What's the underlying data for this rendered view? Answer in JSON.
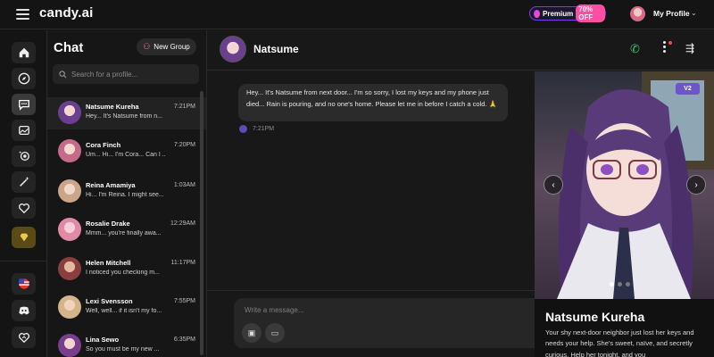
{
  "app": {
    "logo": "candy.ai"
  },
  "topbar": {
    "premium_label": "Premium",
    "premium_discount": "70% OFF",
    "profile_label": "My Profile"
  },
  "rail": {
    "icons": [
      "home-icon",
      "compass-icon",
      "chat-icon",
      "gallery-icon",
      "generate-icon",
      "magic-icon",
      "heart-icon",
      "diamond-icon",
      "us-flag-icon",
      "discord-icon",
      "support-icon"
    ]
  },
  "chat": {
    "title": "Chat",
    "new_group": "New Group",
    "search_placeholder": "Search for a profile...",
    "items": [
      {
        "name": "Natsume Kureha",
        "preview": "Hey... It's Natsume from n...",
        "time": "7:21PM",
        "color": "#6b3f8f"
      },
      {
        "name": "Cora Finch",
        "preview": "Um... Hi... I'm Cora... Can I ...",
        "time": "7:20PM",
        "color": "#c56a8a"
      },
      {
        "name": "Reina Amamiya",
        "preview": "Hi... I'm Reina. I might see...",
        "time": "1:03AM",
        "color": "#d8b7a0"
      },
      {
        "name": "Rosalie Drake",
        "preview": "Mmm... you're finally awa...",
        "time": "12:29AM",
        "color": "#e08aa8"
      },
      {
        "name": "Helen Mitchell",
        "preview": "I noticed you checking m...",
        "time": "11:17PM",
        "color": "#8a3f3f"
      },
      {
        "name": "Lexi Svensson",
        "preview": "Well, well... if it isn't my fo...",
        "time": "7:55PM",
        "color": "#d4b48a"
      },
      {
        "name": "Lina Sewo",
        "preview": "So you must be my new ...",
        "time": "6:35PM",
        "color": "#7a3e8c"
      }
    ]
  },
  "conversation": {
    "name": "Natsume",
    "message": "Hey... It's Natsume from next door... I'm so sorry, I lost my keys and my phone just died... Rain is pouring, and no one's home. Please let me in before I catch a cold. 🙏",
    "message_time": "7:21PM",
    "composer_placeholder": "Write a message..."
  },
  "profile_panel": {
    "badge": "V2",
    "name": "Natsume Kureha",
    "description": "Your shy next-door neighbor just lost her keys and needs your help. She's sweet, naïve, and secretly curious. Help her tonight, and you",
    "carousel_active_index": 0,
    "carousel_count": 3
  },
  "colors": {
    "accent_purple": "#7d3aed",
    "accent_pink": "#ff4fa3",
    "call_green": "#3ec46d",
    "notification_red": "#ff4444"
  }
}
